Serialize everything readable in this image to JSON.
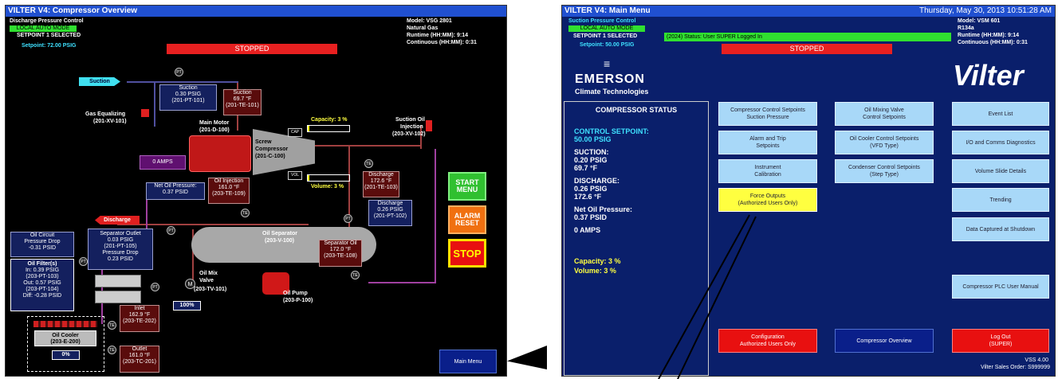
{
  "overview": {
    "title": "VILTER V4: Compressor Overview",
    "mode_label": "Discharge Pressure Control",
    "mode": "LOCAL AUTO MODE",
    "setpoint_selected": "SETPOINT 1 SELECTED",
    "setpoint": "Setpoint: 72.00 PSIG",
    "model": "Model: VSG 2801",
    "gas": "Natural Gas",
    "runtime": "Runtime (HH:MM): 9:14",
    "continuous": "Continuous (HH:MM): 0:31",
    "status": "STOPPED",
    "suction_tag": "Suction",
    "suction_pressure": [
      "Suction",
      "0.30 PSIG",
      "(201-PT-101)"
    ],
    "suction_temp": [
      "Suction",
      "69.7 °F",
      "(201-TE-101)"
    ],
    "gas_equalizing": [
      "Gas Equalizing",
      "(201-XV-101)"
    ],
    "main_motor": [
      "Main Motor",
      "(201-D-100)"
    ],
    "amps": "0 AMPS",
    "compressor": [
      "Screw",
      "Compressor",
      "(201-C-100)"
    ],
    "cap": "CAP",
    "vol": "VOL",
    "capacity": "Capacity: 3 %",
    "volume": "Volume: 3 %",
    "suction_oil_injection": [
      "Suction Oil",
      "Injection",
      "(203-XV-102)"
    ],
    "net_oil": [
      "Net Oil Pressure:",
      "0.37 PSID"
    ],
    "oil_injection": [
      "Oil Injection",
      "161.0 °F",
      "(203-TE-109)"
    ],
    "discharge_temp": [
      "Discharge",
      "172.6 °F",
      "(201-TE-103)"
    ],
    "discharge_pressure": [
      "Discharge",
      "0.26 PSIG",
      "(201-PT-102)"
    ],
    "discharge_tag": "Discharge",
    "oil_circuit": [
      "Oil Circuit",
      "Pressure Drop",
      "-0.31 PSID"
    ],
    "separator_outlet": [
      "Separator Outlet",
      "0.03 PSIG",
      "(201-PT-105)",
      "Pressure Drop",
      "0.23 PSID"
    ],
    "oil_separator": [
      "Oil Separator",
      "(203-V-100)"
    ],
    "separator_oil": [
      "Separator Oil",
      "172.0 °F",
      "(203-TE-108)"
    ],
    "oil_filter": [
      "Oil Filter(s)",
      "In: 0.39 PSIG",
      "(203-PT-103)",
      "Out: 0.57 PSIG",
      "(203-PT-104)",
      "Diff: -0.28 PSID"
    ],
    "oil_mix_valve": [
      "Oil Mix",
      "Valve",
      "(203-TV-101)"
    ],
    "mix_percent": "100%",
    "oil_pump": [
      "Oil Pump",
      "(203-P-100)"
    ],
    "inlet": [
      "Inlet",
      "162.9 °F",
      "(203-TE-202)"
    ],
    "outlet": [
      "Outlet",
      "161.0 °F",
      "(203-TC-201)"
    ],
    "oil_cooler": [
      "Oil Cooler",
      "(203-E-200)"
    ],
    "cooler_percent": "0%",
    "start_menu": "START MENU",
    "alarm_reset": "ALARM RESET",
    "stop": "STOP",
    "main_menu": "Main Menu",
    "instruments": {
      "pt": "PT",
      "te": "TE",
      "m": "M"
    }
  },
  "menu": {
    "title": "VILTER V4: Main Menu",
    "datetime": "Thursday, May 30, 2013 10:51:28 AM",
    "mode_label": "Suction Pressure Control",
    "mode": "LOCAL AUTO MODE",
    "setpoint_selected": "SETPOINT 1 SELECTED",
    "setpoint": "Setpoint: 50.00 PSIG",
    "status_banner": "(2024) Status: User SUPER Logged In",
    "status": "STOPPED",
    "model": "Model: VSM 601",
    "refrigerant": "R134a",
    "runtime": "Runtime (HH:MM): 9:14",
    "continuous": "Continuous (HH:MM): 0:31",
    "brand_emerson": "EMERSON",
    "brand_emerson_sub": "Climate Technologies",
    "brand_vilter": "Vilter",
    "compressor_status": {
      "heading": "COMPRESSOR STATUS",
      "control_label": "CONTROL SETPOINT:",
      "control_value": "50.00 PSIG",
      "suction_label": "SUCTION:",
      "suction_p": "0.20 PSIG",
      "suction_t": "69.7 °F",
      "discharge_label": "DISCHARGE:",
      "discharge_p": "0.26 PSIG",
      "discharge_t": "172.6 °F",
      "net_oil_label": "Net Oil Pressure:",
      "net_oil_value": "0.37 PSID",
      "amps": "0 AMPS",
      "capacity": "Capacity: 3 %",
      "volume": "Volume: 3 %"
    },
    "col1": [
      "Compressor Control Setpoints\nSuction Pressure",
      "Alarm and Trip\nSetpoints",
      "Instrument\nCalibration",
      "Force Outputs\n(Authorized Users Only)"
    ],
    "col2": [
      "Oil Mixing Valve\nControl Setpoints",
      "Oil Cooler Control Setpoints\n(VFD Type)",
      "Condenser Control Setpoints\n(Step Type)"
    ],
    "col3": [
      "Event List",
      "I/O and Comms Diagnostics",
      "Volume Slide Details",
      "Trending",
      "Data Captured at Shutdown",
      "Compressor PLC User Manual"
    ],
    "configuration": "Configuration\nAuthorized Users Only",
    "compressor_overview": "Compressor Overview",
    "logout": "Log Out\n(SUPER)",
    "version": "VSS 4.00",
    "sales_order": "Vilter Sales Order: S999999"
  },
  "colors": {
    "title_blue": "#2050d0",
    "stopped_red": "#e82020",
    "mode_green": "#30e030",
    "menu_bg": "#0a1f6b",
    "button_blue": "#a8d8f8",
    "yellow": "#ffff40"
  }
}
